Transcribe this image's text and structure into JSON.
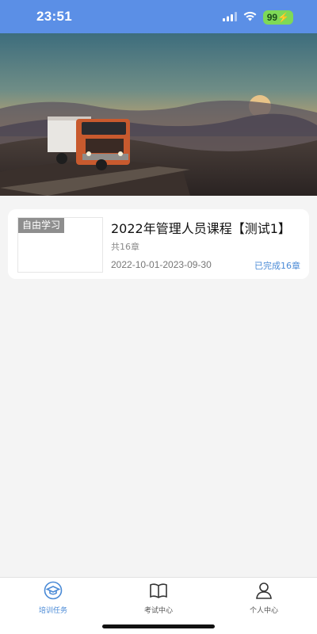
{
  "status_bar": {
    "time": "23:51",
    "battery": "99",
    "colors": {
      "background": "#5b8fe6"
    }
  },
  "banner": {
    "image": "truck-on-mountain-road-at-sunset"
  },
  "course": {
    "tag": "自由学习",
    "title": "2022年管理人员课程【测试1】",
    "chapters": "共16章",
    "date_range": "2022-10-01-2023-09-30",
    "progress": "已完成16章"
  },
  "tab_bar": {
    "tabs": [
      {
        "label": "培训任务",
        "icon": "graduation-cap-icon",
        "active": true
      },
      {
        "label": "考试中心",
        "icon": "open-book-icon",
        "active": false
      },
      {
        "label": "个人中心",
        "icon": "person-icon",
        "active": false
      }
    ],
    "colors": {
      "active": "#4a8ad6",
      "inactive": "#555555"
    }
  }
}
